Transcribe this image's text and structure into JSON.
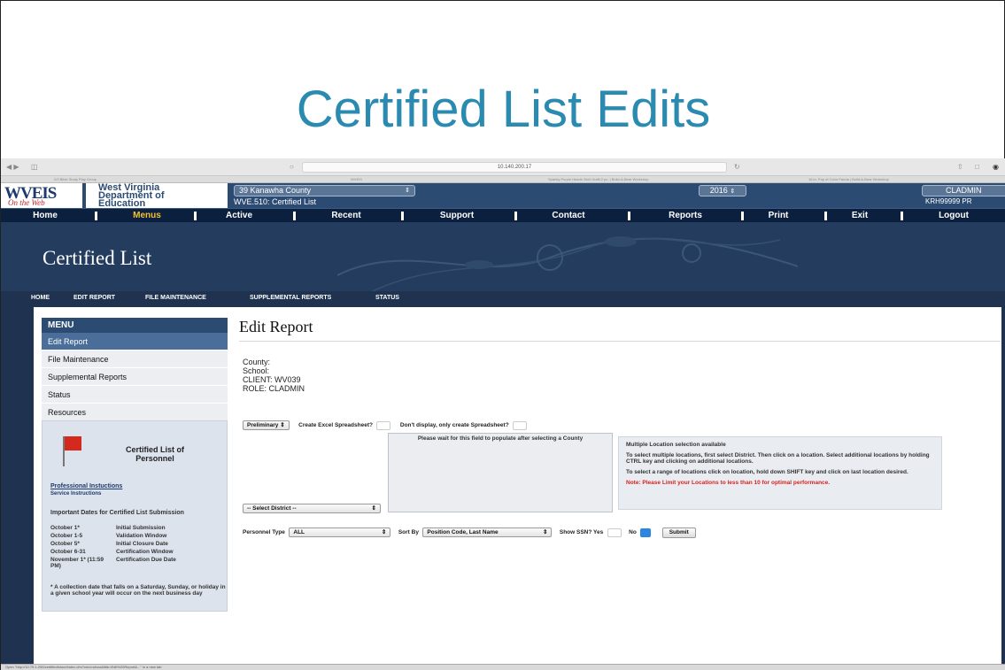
{
  "slide": {
    "title": "Certified List Edits"
  },
  "browser": {
    "url": "10.140.200.17",
    "tabs": [
      "2/3 Bible Study Play Group",
      "WVEIS",
      "Sparkly Purple Hearts Skirt Outfit 2 pc. | Build-A-Bear Workshop",
      "16 in. Pop of Color Panda | Build-A-Bear Workshop"
    ],
    "status_text": "Open \"http://10.79.1.200/certified/store/index.cfm?cmd=show&title=Edit%20Report&...\" in a new tab"
  },
  "header": {
    "logo_main": "WVEIS",
    "logo_sub": "On the Web",
    "dept_line1": "West Virginia",
    "dept_line2": "Department of",
    "dept_line3": "Education",
    "county_select": "39 Kanawha County",
    "page_code": "WVE.510: Certified List",
    "year_select": "2016",
    "user_select": "CLADMIN",
    "user_id": "KRH99999 PR"
  },
  "nav": {
    "items": [
      "Home",
      "Menus",
      "Active",
      "Recent",
      "Support",
      "Contact",
      "Reports",
      "Print",
      "Exit",
      "Logout"
    ],
    "highlight_color": "#f2c230"
  },
  "banner": {
    "title": "Certified List"
  },
  "subnav": {
    "items": [
      "HOME",
      "EDIT REPORT",
      "FILE MAINTENANCE",
      "SUPPLEMENTAL REPORTS",
      "STATUS"
    ]
  },
  "sidebar": {
    "menu_title": "MENU",
    "items": [
      "Edit Report",
      "File Maintenance",
      "Supplemental Reports",
      "Status",
      "Resources"
    ],
    "active_index": 0
  },
  "cert_box": {
    "title": "Certified List of Personnel",
    "link1": "Professional Instuctions",
    "link2": "Service Instructions",
    "dates_heading": "Important Dates for Certified List Submission",
    "dates": [
      {
        "date": "October 1*",
        "event": "Initial Submission"
      },
      {
        "date": "October 1-5",
        "event": "Validation Window"
      },
      {
        "date": "October 5*",
        "event": "Initial Closure Date"
      },
      {
        "date": "October 6-31",
        "event": "Certification Window"
      },
      {
        "date": "November 1* (11:59 PM)",
        "event": "Certification Due Date"
      }
    ],
    "footnote": "* A collection date that falls on a Saturday, Sunday, or holiday in a given school year will occur on the next business day"
  },
  "main": {
    "heading": "Edit Report",
    "county_label": "County:",
    "school_label": "School:",
    "client_label": "CLIENT: WV039",
    "role_label": "ROLE: CLADMIN",
    "report_type": "Preliminary",
    "excel_label": "Create Excel Spreadsheet?",
    "no_display_label": "Don't display, only create Spreadsheet?",
    "location_placeholder": "Please wait for this field to populate after selecting a County",
    "district_select": "-- Select District --",
    "note_title": "Multiple Location selection available",
    "note_p1": "To select multiple locations, first select District. Then click on a location. Select additional locations by holding CTRL key and clicking on additional locations.",
    "note_p2": "To select a range of locations click on location, hold down SHIFT key and click on last location desired.",
    "note_warning": "Note: Please Limit your Locations to less than 10 for optimal performance.",
    "personnel_type_label": "Personnel Type",
    "personnel_type_value": "ALL",
    "sort_label": "Sort By",
    "sort_value": "Position Code, Last Name",
    "ssn_label": "Show SSN? Yes",
    "no_label": "No",
    "submit_label": "Submit"
  }
}
